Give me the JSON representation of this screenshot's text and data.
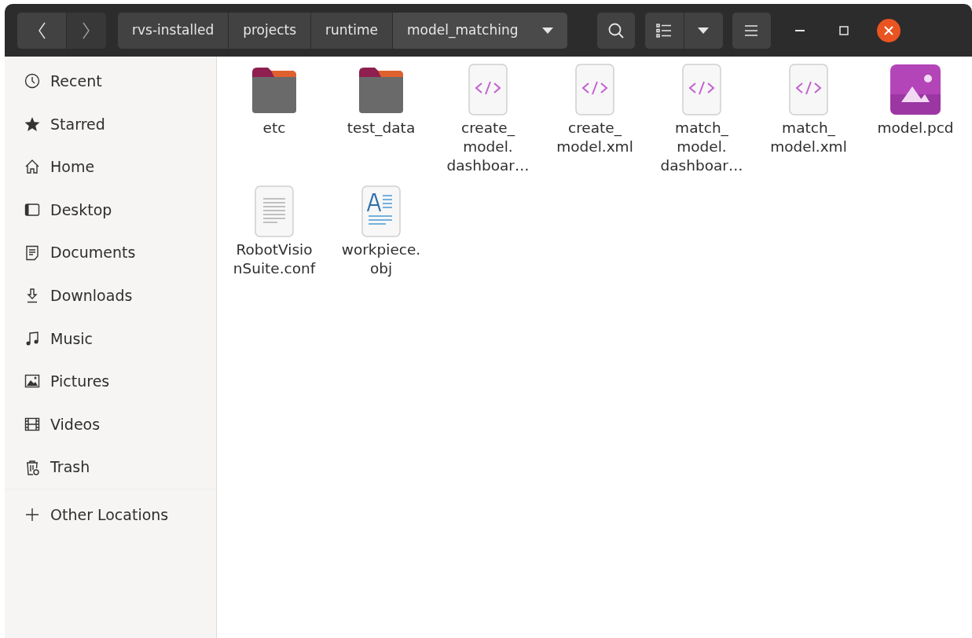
{
  "toolbar": {
    "path": [
      {
        "label": "rvs-installed",
        "selected": false
      },
      {
        "label": "projects",
        "selected": false
      },
      {
        "label": "runtime",
        "selected": false
      },
      {
        "label": "model_matching",
        "selected": true
      }
    ]
  },
  "sidebar": {
    "items": [
      {
        "kind": "recent",
        "label": "Recent"
      },
      {
        "kind": "starred",
        "label": "Starred"
      },
      {
        "kind": "home",
        "label": "Home"
      },
      {
        "kind": "desktop",
        "label": "Desktop"
      },
      {
        "kind": "documents",
        "label": "Documents"
      },
      {
        "kind": "downloads",
        "label": "Downloads"
      },
      {
        "kind": "music",
        "label": "Music"
      },
      {
        "kind": "pictures",
        "label": "Pictures"
      },
      {
        "kind": "videos",
        "label": "Videos"
      },
      {
        "kind": "trash",
        "label": "Trash"
      }
    ],
    "other": {
      "kind": "other",
      "label": "Other Locations"
    }
  },
  "files": [
    {
      "kind": "folder",
      "lines": [
        "etc"
      ]
    },
    {
      "kind": "folder",
      "lines": [
        "test_data"
      ]
    },
    {
      "kind": "code",
      "lines": [
        "create_",
        "model.",
        "dashboar…"
      ]
    },
    {
      "kind": "code",
      "lines": [
        "create_",
        "model.xml"
      ]
    },
    {
      "kind": "code",
      "lines": [
        "match_",
        "model.",
        "dashboar…"
      ]
    },
    {
      "kind": "code",
      "lines": [
        "match_",
        "model.xml"
      ]
    },
    {
      "kind": "image",
      "lines": [
        "model.pcd"
      ]
    },
    {
      "kind": "text",
      "lines": [
        "RobotVisio",
        "nSuite.conf"
      ]
    },
    {
      "kind": "document",
      "lines": [
        "workpiece.",
        "obj"
      ]
    }
  ]
}
